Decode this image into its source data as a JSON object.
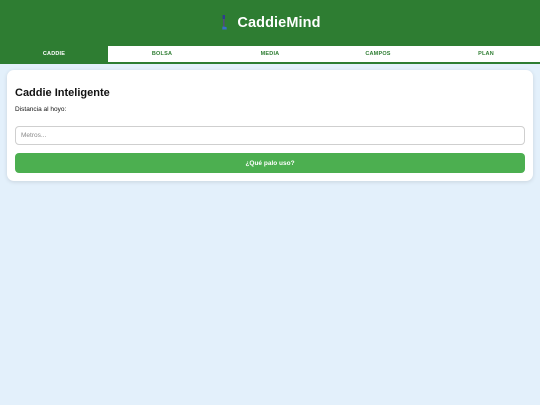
{
  "header": {
    "title": "CaddieMind",
    "logo_icon": "golf-club-icon",
    "background_color": "#2e7d32"
  },
  "nav": {
    "tabs": [
      {
        "label": "CADDIE",
        "active": true
      },
      {
        "label": "BOLSA",
        "active": false
      },
      {
        "label": "MEDIA",
        "active": false
      },
      {
        "label": "CAMPOS",
        "active": false
      },
      {
        "label": "PLAN",
        "active": false
      }
    ]
  },
  "caddie": {
    "title": "Caddie Inteligente",
    "distance_label": "Distancia al hoyo:",
    "distance_value": "",
    "distance_placeholder": "Metros...",
    "submit_label": "¿Qué palo uso?",
    "button_color": "#4caf50"
  }
}
